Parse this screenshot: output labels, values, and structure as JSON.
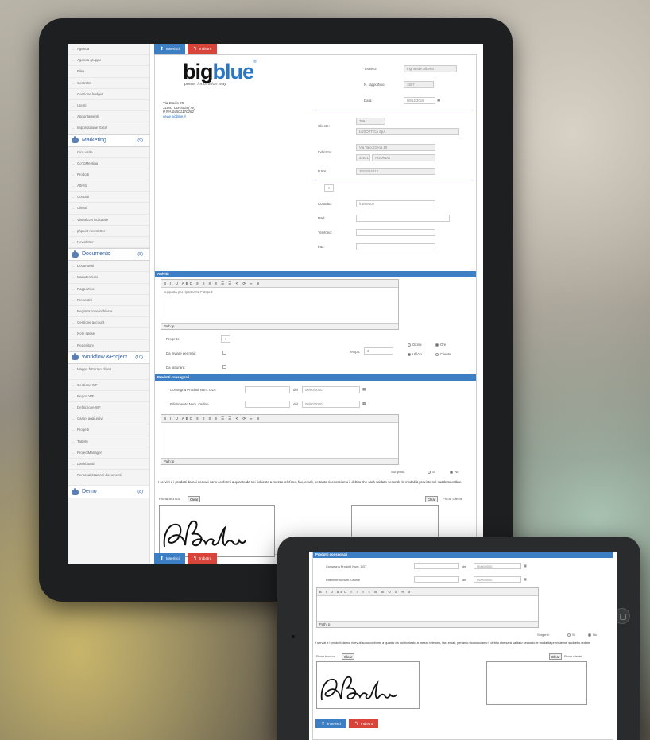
{
  "sidebar": {
    "items_top": [
      "Agenda",
      "Agenda gruppo",
      "Files",
      "Contratto",
      "Gestione budget",
      "Utenti",
      "Appuntamenti",
      "Impostazione Excel"
    ],
    "marketing": {
      "title": "Marketing",
      "count": "(9)",
      "items": [
        "Giro visite",
        "GoToMeeting",
        "Prodotti",
        "Attività",
        "Contatti",
        "Clienti",
        "Visualizza indicative",
        "phpList newsletter",
        "Newsletter"
      ]
    },
    "documents": {
      "title": "Documents",
      "count": "(8)",
      "items": [
        "Documenti",
        "Manutenzioni",
        "Rapportino",
        "Preventivi",
        "Registrazione richieste",
        "Gestione account",
        "Note spese",
        "Repository"
      ]
    },
    "workflow": {
      "title": "Workflow &Project",
      "count": "(10)",
      "items": [
        "Mappa fatturato clienti",
        "Gestione WF",
        "Report WF",
        "Definizione WF",
        "Campi aggiuntivi",
        "Progetti",
        "Tabelle",
        "ProjectManager",
        "Dashboard",
        "Personalizzazioni documenti"
      ]
    },
    "demo": {
      "title": "Demo",
      "count": "(8)"
    }
  },
  "buttons": {
    "insert": "Inserisci",
    "back": "Indietro"
  },
  "logo": {
    "big_black": "big",
    "big_blue": "blue",
    "reg": "®",
    "tagline": "power    innovation way"
  },
  "address": {
    "line1": "Via Emilio 25",
    "line2": "31041 Cornuda (TV)",
    "line3": "P.IVA 04501170262",
    "web": "www.bigblue.it"
  },
  "header": {
    "tecnico_label": "Tecnico:",
    "tecnico_value": "Ing. Bedin Alberto",
    "rapportino_label": "N. rapportino:",
    "rapportino_value": "1507",
    "data_label": "Data:",
    "data_value": "08/12/2015"
  },
  "cliente": {
    "label": "Cliente:",
    "code": "7064",
    "name": "LUXOTTICA SpA",
    "indirizzo_label": "Indirizzo:",
    "via": "Via Valcozzena 10",
    "cap": "32021",
    "citta": "AGORDO",
    "piva_label": "P.IVA:",
    "piva": "1010264013"
  },
  "contatto": {
    "label": "Contatto:",
    "value": "francesco",
    "mail_label": "Mail:",
    "telefono_label": "Telefono:",
    "fax_label": "Fax:"
  },
  "attivita": {
    "section": "Attività",
    "toolbar": "B  I  U  ABC  ≡  ≡  ≡  ≡  ☰  ☰  ⟲  ⟳  ∞  ⊘",
    "text": "supporto per ripartenza Catapult",
    "path": "Path: p",
    "progetto_label": "Progetto:",
    "invio_mail_label": "Da inviare per mail:",
    "fatturare_label": "Da fatturare:",
    "tempo_label": "Tempo:",
    "tempo_value": "2",
    "radio_giorni": "Giorni",
    "radio_ore": "Ore",
    "radio_ufficio": "Ufficio",
    "radio_cliente": "Cliente"
  },
  "prodotti": {
    "section": "Prodotti consegnati",
    "ddt_label": "Consegna Prodotti Num. DDT",
    "ordine_label": "Riferimento Num. Ordine",
    "del_label": "del",
    "date_placeholder": "00/00/0000",
    "path": "Path: p",
    "sorgenti_label": "Sorgenti:",
    "si": "Si",
    "no": "No"
  },
  "disclaimer": "I servizi e i prodotti da noi ricevuti sono conformi a quanto da noi richiesto a mezzo telefono, fax, email, pertanto riconosciamo il debito che sarà saldato secondo le modalità previste nel suddetto ordine.",
  "firma": {
    "tecnico": "Firma tecnico",
    "cliente": "Firma cliente",
    "clear": "Clear",
    "signature": "ABedin"
  }
}
